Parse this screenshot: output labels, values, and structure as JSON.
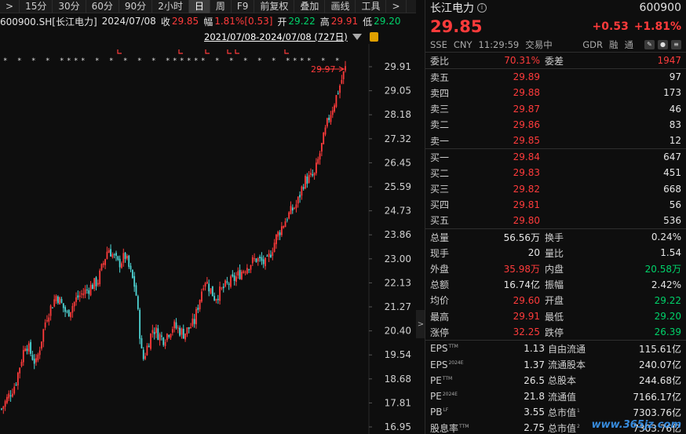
{
  "toolbar": {
    "items": [
      ">",
      "15分",
      "30分",
      "60分",
      "90分",
      "2小时",
      "日",
      "周",
      "F9",
      "前复权",
      "叠加",
      "画线",
      "工具",
      ">"
    ],
    "active_index": 6
  },
  "info": {
    "symbol": "600900.SH[长江电力]",
    "date": "2024/07/08",
    "close_label": "收",
    "close": "29.85",
    "amp_label": "幅",
    "amp": "1.81%[0.53]",
    "open_label": "开",
    "open": "29.22",
    "high_label": "高",
    "high": "29.91",
    "low_label": "低",
    "low": "29.20"
  },
  "date_range": "2021/07/08-2024/07/08 (727日)",
  "chart_data": {
    "type": "candlestick",
    "y_ticks": [
      "29.91",
      "29.05",
      "28.18",
      "27.32",
      "26.45",
      "25.59",
      "24.73",
      "23.86",
      "23.00",
      "22.13",
      "21.27",
      "20.40",
      "19.54",
      "18.68",
      "17.81",
      "16.95"
    ],
    "ylim": [
      16.95,
      29.91
    ],
    "max_label": "29.97",
    "trend_path": [
      [
        0.0,
        17.6
      ],
      [
        0.04,
        18.5
      ],
      [
        0.07,
        20.0
      ],
      [
        0.1,
        19.2
      ],
      [
        0.13,
        20.9
      ],
      [
        0.16,
        21.7
      ],
      [
        0.19,
        21.0
      ],
      [
        0.22,
        21.6
      ],
      [
        0.25,
        21.9
      ],
      [
        0.28,
        22.2
      ],
      [
        0.31,
        23.4
      ],
      [
        0.34,
        22.8
      ],
      [
        0.36,
        23.1
      ],
      [
        0.39,
        21.9
      ],
      [
        0.41,
        19.3
      ],
      [
        0.44,
        20.5
      ],
      [
        0.47,
        20.1
      ],
      [
        0.5,
        20.6
      ],
      [
        0.53,
        20.3
      ],
      [
        0.56,
        20.7
      ],
      [
        0.59,
        22.3
      ],
      [
        0.62,
        21.6
      ],
      [
        0.65,
        22.0
      ],
      [
        0.68,
        22.3
      ],
      [
        0.71,
        22.7
      ],
      [
        0.74,
        23.0
      ],
      [
        0.77,
        22.8
      ],
      [
        0.8,
        23.8
      ],
      [
        0.83,
        24.5
      ],
      [
        0.86,
        25.0
      ],
      [
        0.88,
        25.8
      ],
      [
        0.91,
        26.0
      ],
      [
        0.93,
        27.0
      ],
      [
        0.95,
        28.0
      ],
      [
        0.97,
        28.7
      ],
      [
        1.0,
        29.85
      ]
    ]
  },
  "panel": {
    "name": "长江电力",
    "info_icon": "info-icon",
    "code": "600900",
    "price": "29.85",
    "change": "+0.53 +1.81%",
    "meta": [
      "SSE",
      "CNY",
      "11:29:59",
      "交易中",
      "GDR",
      "融",
      "通"
    ],
    "committee": {
      "l1": "委比",
      "v1": "70.31%",
      "l2": "委差",
      "v2": "1947"
    },
    "asks": [
      {
        "label": "卖五",
        "price": "29.89",
        "vol": "97"
      },
      {
        "label": "卖四",
        "price": "29.88",
        "vol": "173"
      },
      {
        "label": "卖三",
        "price": "29.87",
        "vol": "46"
      },
      {
        "label": "卖二",
        "price": "29.86",
        "vol": "83"
      },
      {
        "label": "卖一",
        "price": "29.85",
        "vol": "12"
      }
    ],
    "bids": [
      {
        "label": "买一",
        "price": "29.84",
        "vol": "647"
      },
      {
        "label": "买二",
        "price": "29.83",
        "vol": "451"
      },
      {
        "label": "买三",
        "price": "29.82",
        "vol": "668"
      },
      {
        "label": "买四",
        "price": "29.81",
        "vol": "56"
      },
      {
        "label": "买五",
        "price": "29.80",
        "vol": "536"
      }
    ],
    "stats": [
      {
        "l1": "总量",
        "v1": "56.56万",
        "c1": "white",
        "l2": "换手",
        "v2": "0.24%",
        "c2": "white"
      },
      {
        "l1": "现手",
        "v1": "20",
        "c1": "white",
        "l2": "量比",
        "v2": "1.54",
        "c2": "white"
      },
      {
        "l1": "外盘",
        "v1": "35.98万",
        "c1": "red",
        "l2": "内盘",
        "v2": "20.58万",
        "c2": "green"
      },
      {
        "l1": "总额",
        "v1": "16.74亿",
        "c1": "white",
        "l2": "振幅",
        "v2": "2.42%",
        "c2": "white"
      },
      {
        "l1": "均价",
        "v1": "29.60",
        "c1": "red",
        "l2": "开盘",
        "v2": "29.22",
        "c2": "green"
      },
      {
        "l1": "最高",
        "v1": "29.91",
        "c1": "red",
        "l2": "最低",
        "v2": "29.20",
        "c2": "green"
      },
      {
        "l1": "涨停",
        "v1": "32.25",
        "c1": "red",
        "l2": "跌停",
        "v2": "26.39",
        "c2": "green"
      }
    ],
    "fin": [
      {
        "l1": "EPS",
        "s1": "TTM",
        "v1": "1.13",
        "l2": "自由流通",
        "s2": "",
        "v2": "115.61亿"
      },
      {
        "l1": "EPS",
        "s1": "2024E",
        "v1": "1.37",
        "l2": "流通股本",
        "s2": "",
        "v2": "240.07亿"
      },
      {
        "l1": "PE",
        "s1": "TTM",
        "v1": "26.5",
        "l2": "总股本",
        "s2": "",
        "v2": "244.68亿"
      },
      {
        "l1": "PE",
        "s1": "2024E",
        "v1": "21.8",
        "l2": "流通值",
        "s2": "",
        "v2": "7166.17亿"
      },
      {
        "l1": "PB",
        "s1": "LF",
        "v1": "3.55",
        "l2": "总市值",
        "s2": "1",
        "v2": "7303.76亿"
      },
      {
        "l1": "股息率",
        "s1": "TTM",
        "v1": "2.75",
        "l2": "总市值",
        "s2": "2",
        "v2": "7303.76亿"
      }
    ]
  },
  "watermark": "www.365jz.com",
  "colors": {
    "up": "#ff3b3b",
    "down": "#4fd6d6",
    "bg": "#0e0e0e"
  }
}
